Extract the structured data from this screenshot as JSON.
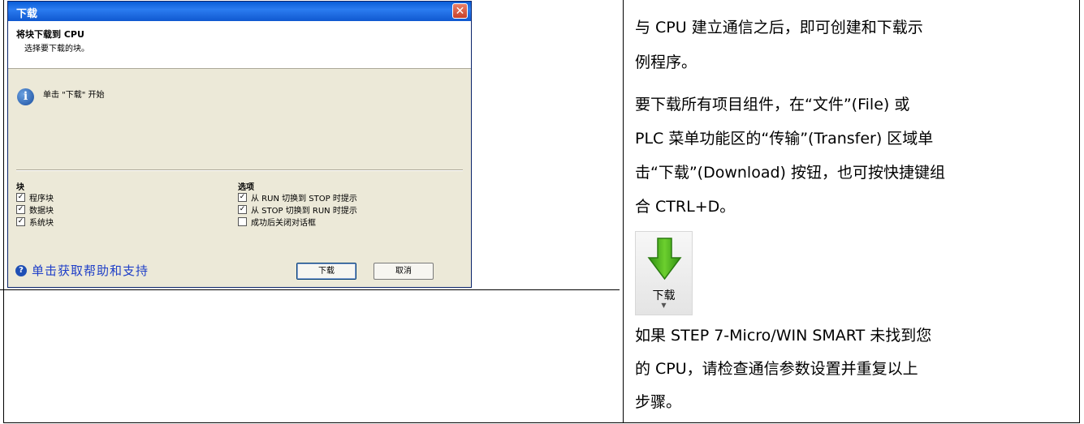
{
  "dialog": {
    "title": "下载",
    "close_glyph": "✕",
    "heading": "将块下载到 CPU",
    "subheading": "选择要下载的块。",
    "info_text": "单击 \"下载\" 开始",
    "blocks": {
      "title": "块",
      "items": [
        {
          "label": "程序块",
          "checked": true
        },
        {
          "label": "数据块",
          "checked": true
        },
        {
          "label": "系统块",
          "checked": true
        }
      ]
    },
    "options": {
      "title": "选项",
      "items": [
        {
          "label": "从 RUN 切换到 STOP 时提示",
          "checked": true
        },
        {
          "label": "从 STOP 切换到 RUN 时提示",
          "checked": true
        },
        {
          "label": "成功后关闭对话框",
          "checked": false
        }
      ]
    },
    "help_link": "单击获取帮助和支持",
    "download_button": "下载",
    "cancel_button": "取消"
  },
  "instructions": {
    "para1_line1": "与 CPU 建立通信之后，即可创建和下载示",
    "para1_line2": "例程序。",
    "para2_line1": "要下载所有项目组件，在“文件”(File) 或",
    "para2_line2": "PLC 菜单功能区的“传输”(Transfer) 区域单",
    "para2_line3": "击“下载”(Download) 按钮，也可按快捷键组",
    "para2_line4": "合 CTRL+D。",
    "ribbon_button_label": "下载",
    "para3_line1": "如果 STEP 7-Micro/WIN SMART 未找到您",
    "para3_line2": "的 CPU，请检查通信参数设置并重复以上",
    "para3_line3": "步骤。"
  },
  "colors": {
    "titlebar": "#0a5ed8",
    "dialog_bg": "#ece9d8",
    "help_link": "#1f3fc8",
    "download_arrow": "#3fae1a"
  }
}
